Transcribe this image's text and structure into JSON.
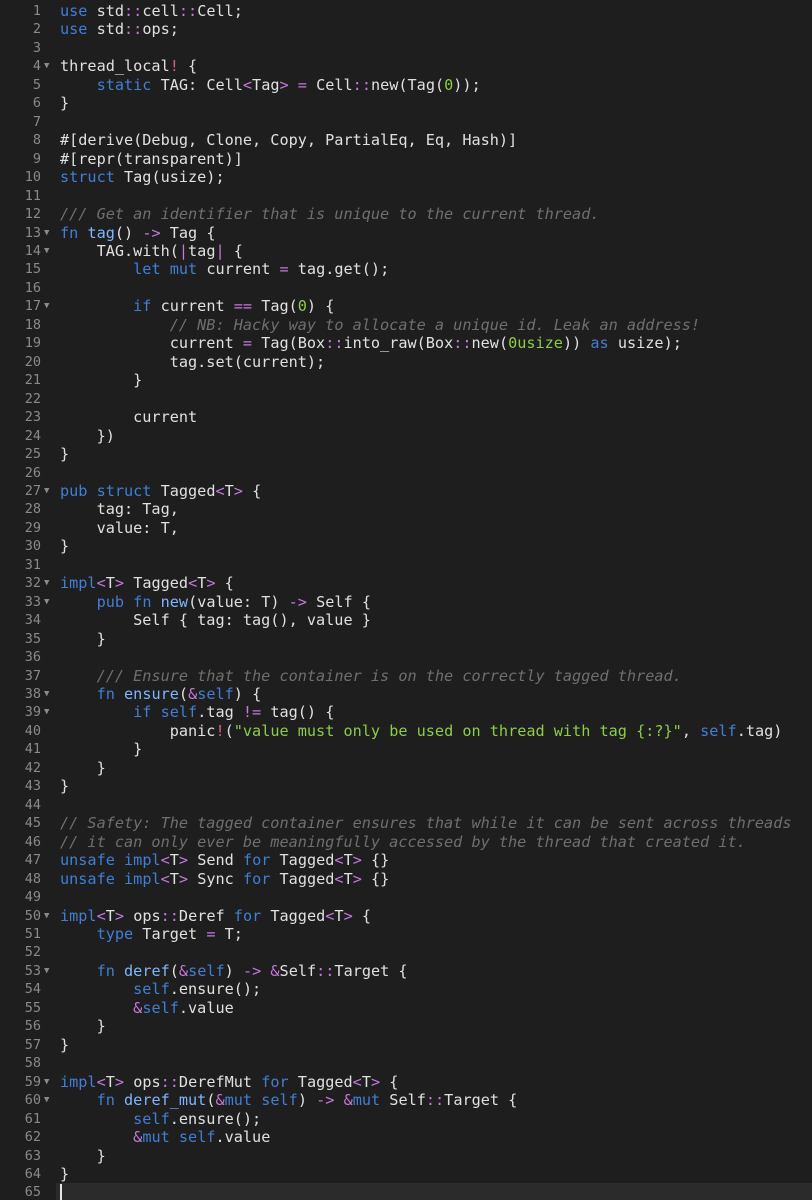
{
  "editor": {
    "language": "rust",
    "current_line": 65,
    "folded_markers": [
      4,
      13,
      14,
      17,
      27,
      32,
      33,
      38,
      39,
      50,
      53,
      59,
      60
    ],
    "lines": [
      [
        [
          "kw",
          "use"
        ],
        [
          "t",
          " std"
        ],
        [
          "op",
          "::"
        ],
        [
          "t",
          "cell"
        ],
        [
          "op",
          "::"
        ],
        [
          "t",
          "Cell;"
        ]
      ],
      [
        [
          "kw",
          "use"
        ],
        [
          "t",
          " std"
        ],
        [
          "op",
          "::"
        ],
        [
          "t",
          "ops;"
        ]
      ],
      [],
      [
        [
          "t",
          "thread_local"
        ],
        [
          "mc",
          "!"
        ],
        [
          "t",
          " {"
        ]
      ],
      [
        [
          "t",
          "    "
        ],
        [
          "kw",
          "static"
        ],
        [
          "t",
          " TAG: Cell"
        ],
        [
          "op",
          "<"
        ],
        [
          "t",
          "Tag"
        ],
        [
          "op",
          ">"
        ],
        [
          "t",
          " "
        ],
        [
          "op",
          "="
        ],
        [
          "t",
          " Cell"
        ],
        [
          "op",
          "::"
        ],
        [
          "t",
          "new(Tag("
        ],
        [
          "nu",
          "0"
        ],
        [
          "t",
          "));"
        ]
      ],
      [
        [
          "t",
          "}"
        ]
      ],
      [],
      [
        [
          "t",
          "#[derive(Debug, Clone, Copy, PartialEq, Eq, Hash)]"
        ]
      ],
      [
        [
          "t",
          "#[repr(transparent)]"
        ]
      ],
      [
        [
          "kw",
          "struct"
        ],
        [
          "t",
          " Tag(usize);"
        ]
      ],
      [],
      [
        [
          "cm",
          "/// Get an identifier that is unique to the current thread."
        ]
      ],
      [
        [
          "kw",
          "fn"
        ],
        [
          "t",
          " "
        ],
        [
          "fn",
          "tag"
        ],
        [
          "t",
          "() "
        ],
        [
          "op",
          "->"
        ],
        [
          "t",
          " Tag {"
        ]
      ],
      [
        [
          "t",
          "    TAG.with("
        ],
        [
          "op",
          "|"
        ],
        [
          "t",
          "tag"
        ],
        [
          "op",
          "|"
        ],
        [
          "t",
          " {"
        ]
      ],
      [
        [
          "t",
          "        "
        ],
        [
          "kw",
          "let"
        ],
        [
          "t",
          " "
        ],
        [
          "kw",
          "mut"
        ],
        [
          "t",
          " current "
        ],
        [
          "op",
          "="
        ],
        [
          "t",
          " tag.get();"
        ]
      ],
      [],
      [
        [
          "t",
          "        "
        ],
        [
          "kw",
          "if"
        ],
        [
          "t",
          " current "
        ],
        [
          "op",
          "=="
        ],
        [
          "t",
          " Tag("
        ],
        [
          "nu",
          "0"
        ],
        [
          "t",
          ") {"
        ]
      ],
      [
        [
          "t",
          "            "
        ],
        [
          "cm",
          "// NB: Hacky way to allocate a unique id. Leak an address!"
        ]
      ],
      [
        [
          "t",
          "            current "
        ],
        [
          "op",
          "="
        ],
        [
          "t",
          " Tag(Box"
        ],
        [
          "op",
          "::"
        ],
        [
          "t",
          "into_raw(Box"
        ],
        [
          "op",
          "::"
        ],
        [
          "t",
          "new("
        ],
        [
          "nu",
          "0usize"
        ],
        [
          "t",
          ")) "
        ],
        [
          "kw",
          "as"
        ],
        [
          "t",
          " usize);"
        ]
      ],
      [
        [
          "t",
          "            tag.set(current);"
        ]
      ],
      [
        [
          "t",
          "        }"
        ]
      ],
      [],
      [
        [
          "t",
          "        current"
        ]
      ],
      [
        [
          "t",
          "    })"
        ]
      ],
      [
        [
          "t",
          "}"
        ]
      ],
      [],
      [
        [
          "kw",
          "pub"
        ],
        [
          "t",
          " "
        ],
        [
          "kw",
          "struct"
        ],
        [
          "t",
          " Tagged"
        ],
        [
          "op",
          "<"
        ],
        [
          "t",
          "T"
        ],
        [
          "op",
          ">"
        ],
        [
          "t",
          " {"
        ]
      ],
      [
        [
          "t",
          "    tag: Tag,"
        ]
      ],
      [
        [
          "t",
          "    value: T,"
        ]
      ],
      [
        [
          "t",
          "}"
        ]
      ],
      [],
      [
        [
          "kw",
          "impl"
        ],
        [
          "op",
          "<"
        ],
        [
          "t",
          "T"
        ],
        [
          "op",
          ">"
        ],
        [
          "t",
          " Tagged"
        ],
        [
          "op",
          "<"
        ],
        [
          "t",
          "T"
        ],
        [
          "op",
          ">"
        ],
        [
          "t",
          " {"
        ]
      ],
      [
        [
          "t",
          "    "
        ],
        [
          "kw",
          "pub"
        ],
        [
          "t",
          " "
        ],
        [
          "kw",
          "fn"
        ],
        [
          "t",
          " "
        ],
        [
          "fn",
          "new"
        ],
        [
          "t",
          "(value: T) "
        ],
        [
          "op",
          "->"
        ],
        [
          "t",
          " Self {"
        ]
      ],
      [
        [
          "t",
          "        Self { tag: tag(), value }"
        ]
      ],
      [
        [
          "t",
          "    }"
        ]
      ],
      [],
      [
        [
          "t",
          "    "
        ],
        [
          "cm",
          "/// Ensure that the container is on the correctly tagged thread."
        ]
      ],
      [
        [
          "t",
          "    "
        ],
        [
          "kw",
          "fn"
        ],
        [
          "t",
          " "
        ],
        [
          "fn",
          "ensure"
        ],
        [
          "t",
          "("
        ],
        [
          "op",
          "&"
        ],
        [
          "kw",
          "self"
        ],
        [
          "t",
          ") {"
        ]
      ],
      [
        [
          "t",
          "        "
        ],
        [
          "kw",
          "if"
        ],
        [
          "t",
          " "
        ],
        [
          "kw",
          "self"
        ],
        [
          "t",
          ".tag "
        ],
        [
          "op",
          "!="
        ],
        [
          "t",
          " tag() {"
        ]
      ],
      [
        [
          "t",
          "            panic"
        ],
        [
          "mc",
          "!"
        ],
        [
          "t",
          "("
        ],
        [
          "st",
          "\"value must only be used on thread with tag {:?}\""
        ],
        [
          "t",
          ", "
        ],
        [
          "kw",
          "self"
        ],
        [
          "t",
          ".tag)"
        ]
      ],
      [
        [
          "t",
          "        }"
        ]
      ],
      [
        [
          "t",
          "    }"
        ]
      ],
      [
        [
          "t",
          "}"
        ]
      ],
      [],
      [
        [
          "cm",
          "// Safety: The tagged container ensures that while it can be sent across threads"
        ]
      ],
      [
        [
          "cm",
          "// it can only ever be meaningfully accessed by the thread that created it."
        ]
      ],
      [
        [
          "kw",
          "unsafe"
        ],
        [
          "t",
          " "
        ],
        [
          "kw",
          "impl"
        ],
        [
          "op",
          "<"
        ],
        [
          "t",
          "T"
        ],
        [
          "op",
          ">"
        ],
        [
          "t",
          " Send "
        ],
        [
          "kw",
          "for"
        ],
        [
          "t",
          " Tagged"
        ],
        [
          "op",
          "<"
        ],
        [
          "t",
          "T"
        ],
        [
          "op",
          ">"
        ],
        [
          "t",
          " {}"
        ]
      ],
      [
        [
          "kw",
          "unsafe"
        ],
        [
          "t",
          " "
        ],
        [
          "kw",
          "impl"
        ],
        [
          "op",
          "<"
        ],
        [
          "t",
          "T"
        ],
        [
          "op",
          ">"
        ],
        [
          "t",
          " Sync "
        ],
        [
          "kw",
          "for"
        ],
        [
          "t",
          " Tagged"
        ],
        [
          "op",
          "<"
        ],
        [
          "t",
          "T"
        ],
        [
          "op",
          ">"
        ],
        [
          "t",
          " {}"
        ]
      ],
      [],
      [
        [
          "kw",
          "impl"
        ],
        [
          "op",
          "<"
        ],
        [
          "t",
          "T"
        ],
        [
          "op",
          ">"
        ],
        [
          "t",
          " ops"
        ],
        [
          "op",
          "::"
        ],
        [
          "t",
          "Deref "
        ],
        [
          "kw",
          "for"
        ],
        [
          "t",
          " Tagged"
        ],
        [
          "op",
          "<"
        ],
        [
          "t",
          "T"
        ],
        [
          "op",
          ">"
        ],
        [
          "t",
          " {"
        ]
      ],
      [
        [
          "t",
          "    "
        ],
        [
          "kw",
          "type"
        ],
        [
          "t",
          " Target "
        ],
        [
          "op",
          "="
        ],
        [
          "t",
          " T;"
        ]
      ],
      [],
      [
        [
          "t",
          "    "
        ],
        [
          "kw",
          "fn"
        ],
        [
          "t",
          " "
        ],
        [
          "fn",
          "deref"
        ],
        [
          "t",
          "("
        ],
        [
          "op",
          "&"
        ],
        [
          "kw",
          "self"
        ],
        [
          "t",
          ") "
        ],
        [
          "op",
          "->"
        ],
        [
          "t",
          " "
        ],
        [
          "op",
          "&"
        ],
        [
          "t",
          "Self"
        ],
        [
          "op",
          "::"
        ],
        [
          "t",
          "Target {"
        ]
      ],
      [
        [
          "t",
          "        "
        ],
        [
          "kw",
          "self"
        ],
        [
          "t",
          ".ensure();"
        ]
      ],
      [
        [
          "t",
          "        "
        ],
        [
          "op",
          "&"
        ],
        [
          "kw",
          "self"
        ],
        [
          "t",
          ".value"
        ]
      ],
      [
        [
          "t",
          "    }"
        ]
      ],
      [
        [
          "t",
          "}"
        ]
      ],
      [],
      [
        [
          "kw",
          "impl"
        ],
        [
          "op",
          "<"
        ],
        [
          "t",
          "T"
        ],
        [
          "op",
          ">"
        ],
        [
          "t",
          " ops"
        ],
        [
          "op",
          "::"
        ],
        [
          "t",
          "DerefMut "
        ],
        [
          "kw",
          "for"
        ],
        [
          "t",
          " Tagged"
        ],
        [
          "op",
          "<"
        ],
        [
          "t",
          "T"
        ],
        [
          "op",
          ">"
        ],
        [
          "t",
          " {"
        ]
      ],
      [
        [
          "t",
          "    "
        ],
        [
          "kw",
          "fn"
        ],
        [
          "t",
          " "
        ],
        [
          "fn",
          "deref_mut"
        ],
        [
          "t",
          "("
        ],
        [
          "op",
          "&"
        ],
        [
          "kw",
          "mut"
        ],
        [
          "t",
          " "
        ],
        [
          "kw",
          "self"
        ],
        [
          "t",
          ") "
        ],
        [
          "op",
          "->"
        ],
        [
          "t",
          " "
        ],
        [
          "op",
          "&"
        ],
        [
          "kw",
          "mut"
        ],
        [
          "t",
          " Self"
        ],
        [
          "op",
          "::"
        ],
        [
          "t",
          "Target {"
        ]
      ],
      [
        [
          "t",
          "        "
        ],
        [
          "kw",
          "self"
        ],
        [
          "t",
          ".ensure();"
        ]
      ],
      [
        [
          "t",
          "        "
        ],
        [
          "op",
          "&"
        ],
        [
          "kw",
          "mut"
        ],
        [
          "t",
          " "
        ],
        [
          "kw",
          "self"
        ],
        [
          "t",
          ".value"
        ]
      ],
      [
        [
          "t",
          "    }"
        ]
      ],
      [
        [
          "t",
          "}"
        ]
      ],
      []
    ]
  }
}
